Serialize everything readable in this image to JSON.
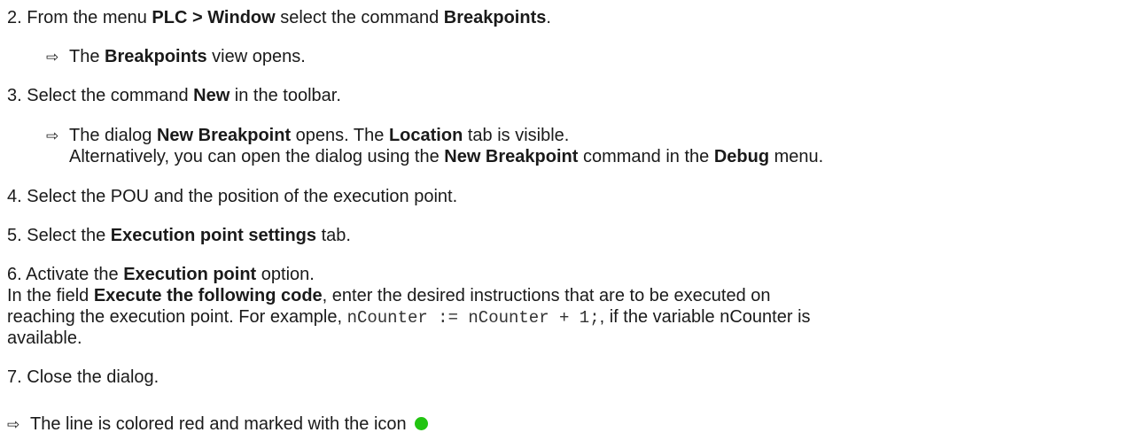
{
  "colors": {
    "text": "#1a1a1a",
    "icon_green": "#22c411"
  },
  "s2": {
    "num": "2.",
    "t1": "From the menu ",
    "b1": "PLC > Window",
    "t2": " select the command ",
    "b2": "Breakpoints",
    "t3": "."
  },
  "r2": {
    "arrow": "⇨",
    "t1": "The ",
    "b1": "Breakpoints",
    "t2": " view opens."
  },
  "s3": {
    "num": "3.",
    "t1": "Select the command ",
    "b1": "New",
    "t2": " in the toolbar."
  },
  "r3": {
    "arrow": "⇨",
    "t1": "The dialog ",
    "b1": "New Breakpoint",
    "t2": " opens. The ",
    "b2": "Location",
    "t3": " tab is visible.",
    "alt_t1": "Alternatively, you can open the dialog using the ",
    "alt_b1": "New Breakpoint",
    "alt_t2": " command in the ",
    "alt_b2": "Debug",
    "alt_t3": " menu."
  },
  "s4": {
    "num": "4.",
    "t1": "Select the POU and the position of the execution point."
  },
  "s5": {
    "num": "5.",
    "t1": "Select the ",
    "b1": "Execution point settings",
    "t2": " tab."
  },
  "s6": {
    "num": "6.",
    "t1": "Activate the ",
    "b1": "Execution point",
    "t2": " option.",
    "l2_t1": "In the field ",
    "l2_b1": "Execute the following code",
    "l2_t2": ", enter the desired instructions that are to be executed on",
    "l3_t1": "reaching the execution point. For example, ",
    "l3_code": "nCounter := nCounter + 1;",
    "l3_t2": ", if the variable nCounter is",
    "l4_t1": "available."
  },
  "s7": {
    "num": "7.",
    "t1": "Close the dialog."
  },
  "result": {
    "arrow": "⇨",
    "t1": "The line is colored red and marked with the icon",
    "icon": "green-circle-icon"
  }
}
